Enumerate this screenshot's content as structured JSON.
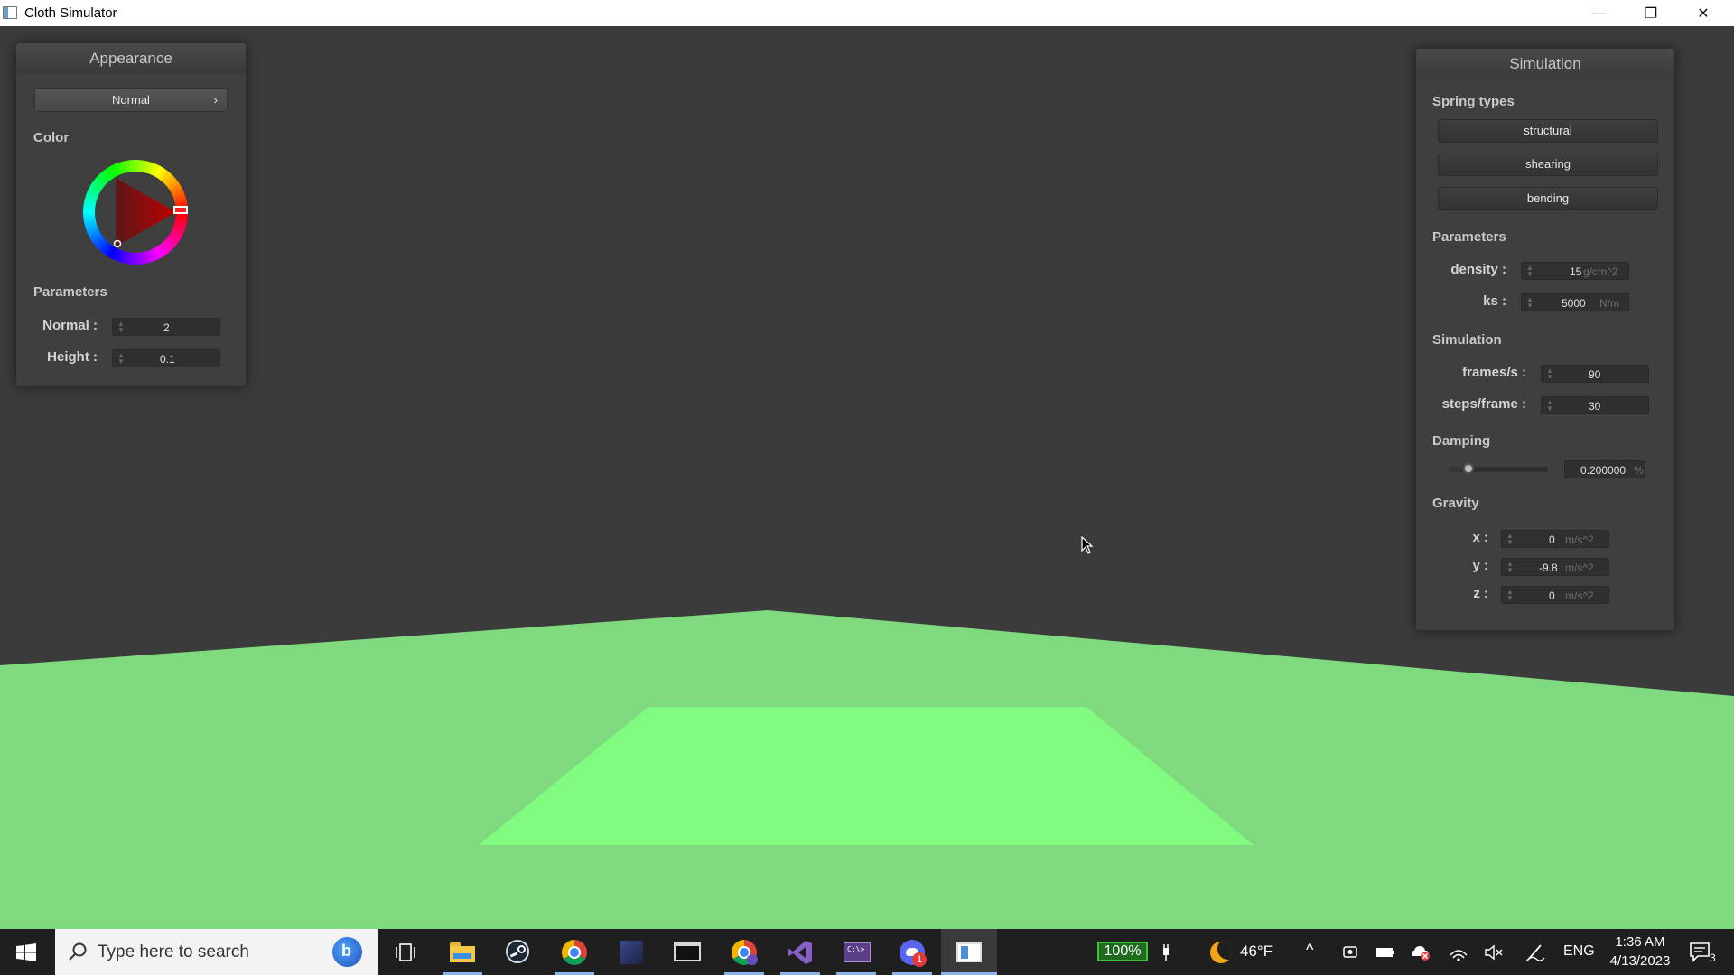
{
  "window": {
    "title": "Cloth Simulator",
    "minimize_glyph": "—",
    "restore_glyph": "❐",
    "close_glyph": "✕"
  },
  "appearance": {
    "header": "Appearance",
    "render_mode": "Normal",
    "chevron": "›",
    "color_label": "Color",
    "selected_color": "#ff0000",
    "parameters_label": "Parameters",
    "normal_label": "Normal :",
    "normal_value": "2",
    "height_label": "Height :",
    "height_value": "0.1"
  },
  "simulation_panel": {
    "header": "Simulation",
    "spring_types_label": "Spring types",
    "structural": "structural",
    "shearing": "shearing",
    "bending": "bending",
    "parameters_label": "Parameters",
    "density_label": "density :",
    "density_value": "15",
    "density_unit": "g/cm^2",
    "ks_label": "ks :",
    "ks_value": "5000",
    "ks_unit": "N/m",
    "simulation_label": "Simulation",
    "fps_label": "frames/s :",
    "fps_value": "90",
    "steps_label": "steps/frame :",
    "steps_value": "30",
    "damping_label": "Damping",
    "damping_value": "0.200000",
    "damping_unit": "%",
    "damping_level": 0.2,
    "gravity_label": "Gravity",
    "gx_label": "x :",
    "gx_value": "0",
    "gy_label": "y :",
    "gy_value": "-9.8",
    "gz_label": "z :",
    "gz_value": "0",
    "gravity_unit": "m/s^2"
  },
  "scene": {
    "floor_color": "#7fd97f",
    "cloth_color": "#80fb80",
    "background_color": "#3b3b3b"
  },
  "taskbar": {
    "search_placeholder": "Type here to search",
    "battery": "100%",
    "temperature": "46°F",
    "language": "ENG",
    "time": "1:36 AM",
    "date": "4/13/2023",
    "notification_count": "3",
    "discord_badge": "1"
  }
}
